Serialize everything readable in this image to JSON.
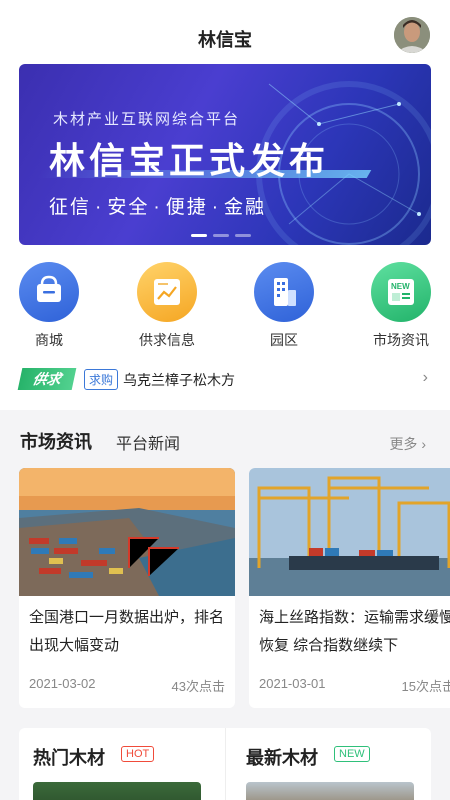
{
  "header": {
    "title": "林信宝"
  },
  "banner": {
    "subtitle": "木材产业互联网综合平台",
    "headline": "林信宝正式发布",
    "tags": [
      "征信",
      "安全",
      "便捷",
      "金融"
    ],
    "dot": "·",
    "slide_count": 3,
    "active_slide": 1
  },
  "quick_nav": [
    {
      "label": "商城",
      "icon": "bag-icon",
      "color": "#3a6fe0"
    },
    {
      "label": "供求信息",
      "icon": "chart-doc-icon",
      "color": "#f5b23a"
    },
    {
      "label": "园区",
      "icon": "building-icon",
      "color": "#3a6fe0"
    },
    {
      "label": "市场资讯",
      "icon": "newspaper-new-icon",
      "color": "#2fc07a"
    }
  ],
  "notice": {
    "badge": "供求",
    "tag": "求购",
    "text": "乌克兰樟子松木方",
    "arrow": "›"
  },
  "news": {
    "tab_active": "市场资讯",
    "tab_other": "平台新闻",
    "more": "更多 ›",
    "items": [
      {
        "title": "全国港口一月数据出炉，排名出现大幅变动",
        "date": "2021-03-02",
        "clicks": "43次点击"
      },
      {
        "title": "海上丝路指数：运输需求缓慢恢复 综合指数继续下",
        "date": "2021-03-01",
        "clicks": "15次点击"
      }
    ]
  },
  "bottom": {
    "hot": {
      "title": "热门木材",
      "tag": "HOT"
    },
    "new": {
      "title": "最新木材",
      "tag": "NEW"
    }
  },
  "colors": {
    "accent_green": "#2fc07a",
    "hot_red": "#f04b3a",
    "new_green": "#2fc07a",
    "link_blue": "#3b78d8"
  }
}
